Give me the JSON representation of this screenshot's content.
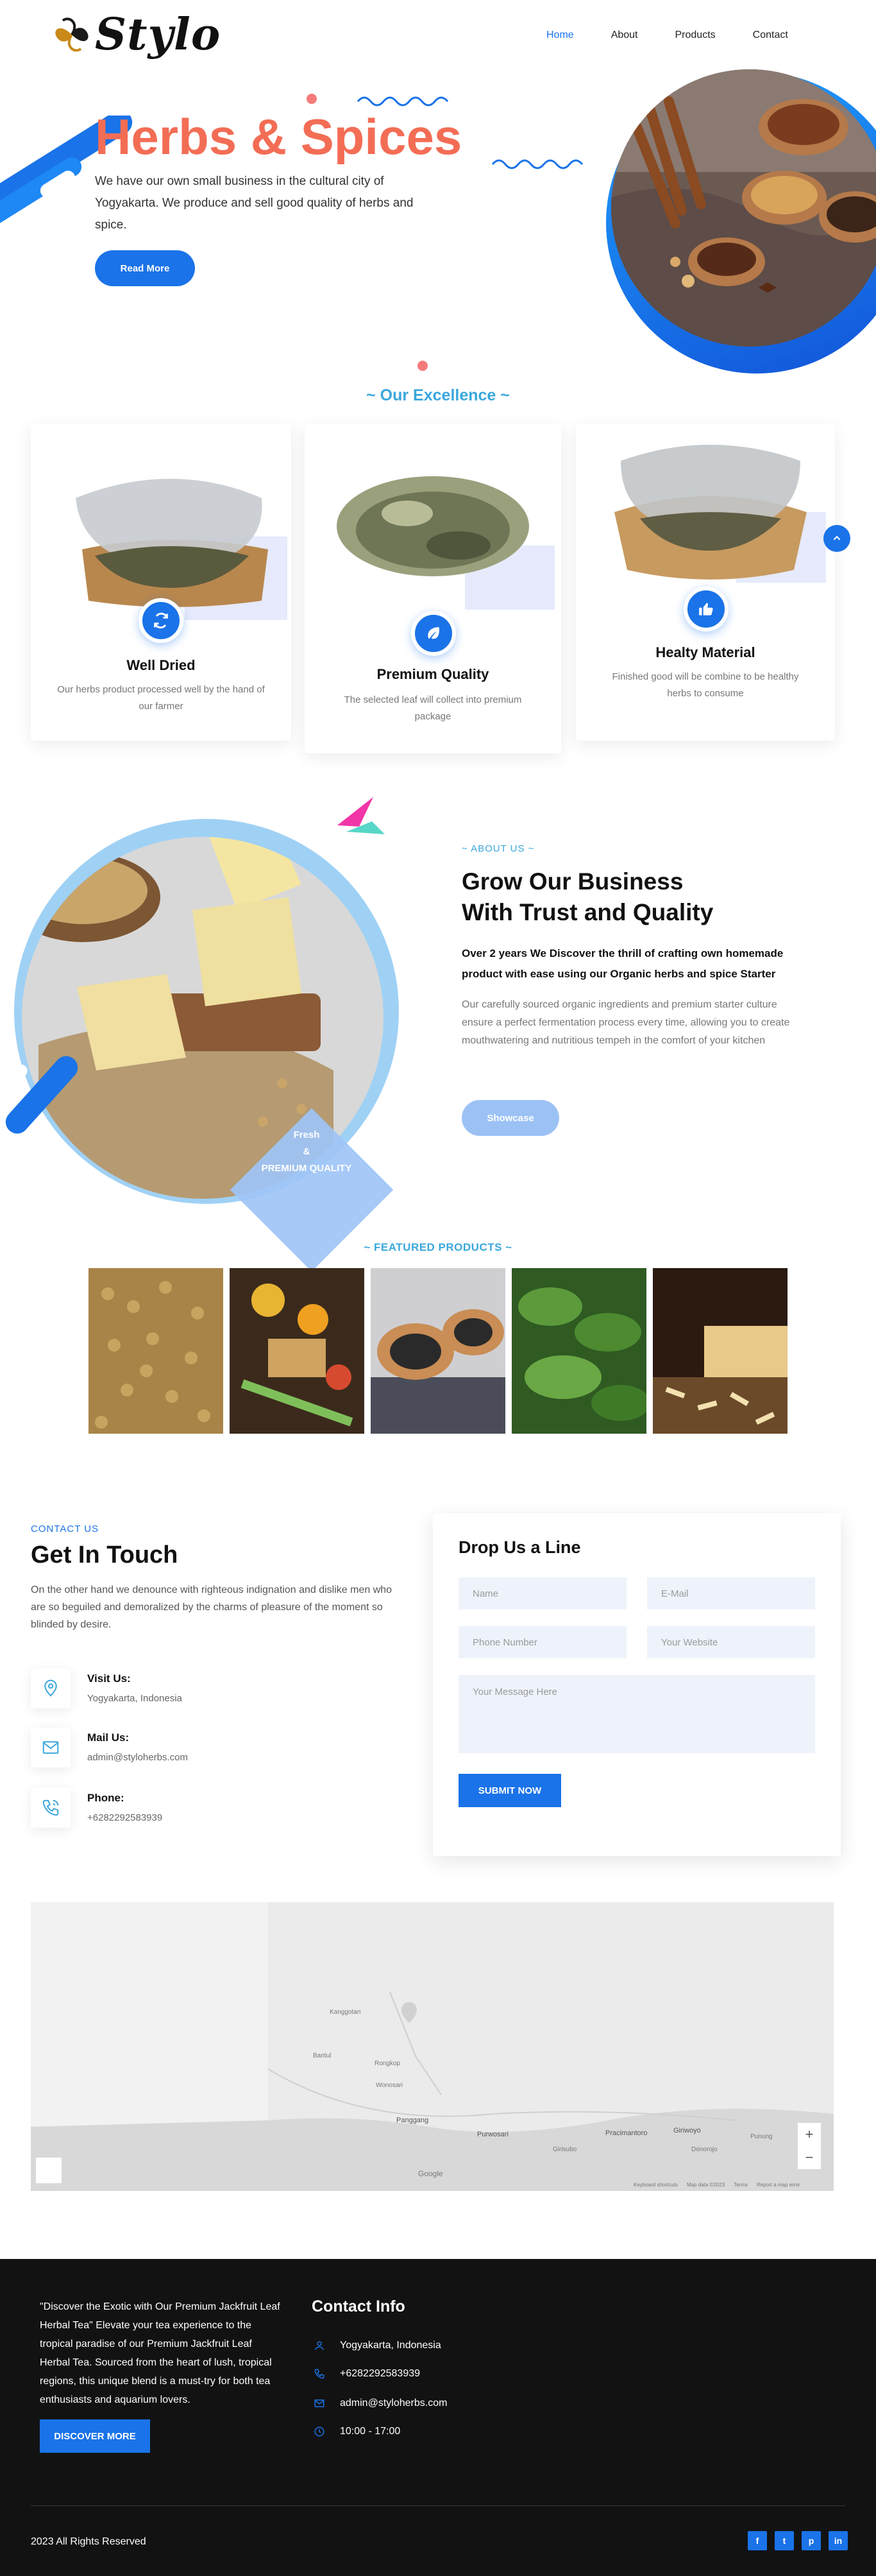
{
  "brand": {
    "name": "Stylo"
  },
  "nav": {
    "items": [
      "Home",
      "About",
      "Products",
      "Contact"
    ],
    "active": "Home"
  },
  "hero": {
    "title": "Herbs & Spices",
    "description": "We have our own small business in the cultural city of Yogyakarta. We produce and sell good quality of herbs and spice.",
    "button": "Read More"
  },
  "excellence": {
    "title": "~ Our Excellence ~",
    "cards": [
      {
        "title": "Well Dried",
        "text": "Our herbs product processed well by the hand of our farmer",
        "icon": "refresh-icon"
      },
      {
        "title": "Premium Quality",
        "text": "The selected leaf will collect into premium package",
        "icon": "leaf-icon"
      },
      {
        "title": "Healty Material",
        "text": "Finished good will be combine to be healthy herbs to consume",
        "icon": "thumbs-up-icon"
      }
    ]
  },
  "about": {
    "label": "~ ABOUT US ~",
    "title_line1": "Grow Our Business",
    "title_line2": "With Trust and Quality",
    "strong": "Over 2 years  We Discover the thrill of crafting own homemade product with ease using our Organic herbs and spice Starter",
    "text": "Our carefully sourced organic ingredients and premium starter culture ensure a perfect fermentation process every time, allowing you to create mouthwatering and nutritious tempeh in the comfort of your kitchen",
    "button": "Showcase",
    "badge_line1": "Fresh",
    "badge_line2": "&",
    "badge_line3": "PREMIUM QUALITY"
  },
  "featured": {
    "title": "~ FEATURED PRODUCTS ~"
  },
  "contact": {
    "label": "CONTACT US",
    "title": "Get In Touch",
    "text": "On the other hand we denounce with righteous indignation and dislike men who are so beguiled and demoralized by the charms of pleasure of the moment so blinded by desire.",
    "items": [
      {
        "head": "Visit Us:",
        "value": "Yogyakarta, Indonesia"
      },
      {
        "head": "Mail Us:",
        "value": "admin@styloherbs.com"
      },
      {
        "head": "Phone:",
        "value": "+6282292583939"
      }
    ]
  },
  "form": {
    "title": "Drop Us a Line",
    "name_placeholder": "Name",
    "email_placeholder": "E-Mail",
    "phone_placeholder": "Phone Number",
    "website_placeholder": "Your Website",
    "message_placeholder": "Your Message Here",
    "submit": "SUBMIT NOW"
  },
  "map": {
    "labels": [
      "Panggang",
      "Purwosari",
      "Pracimantoro",
      "Giriwoyo",
      "Wonosari",
      "Bantul",
      "Kanggotan",
      "Girisubo",
      "Rongkop",
      "Donorojo",
      "Punung"
    ],
    "footer": [
      "Keyboard shortcuts",
      "Map data ©2023",
      "Terms",
      "Report a map error"
    ],
    "google": "Google"
  },
  "footer": {
    "quote": "\"Discover the Exotic with Our Premium Jackfruit Leaf Herbal Tea\" Elevate your tea experience to the tropical paradise of our Premium Jackfruit Leaf Herbal Tea. Sourced from the heart of lush, tropical regions, this unique blend is a must-try for both tea enthusiasts and aquarium lovers.",
    "button": "DISCOVER MORE",
    "contact_title": "Contact Info",
    "address": "Yogyakarta, Indonesia",
    "phone": "+6282292583939",
    "email": "admin@styloherbs.com",
    "hours": "10:00 - 17:00",
    "copyright": "2023 All Rights Reserved",
    "socials": [
      "f",
      "t",
      "p",
      "in"
    ]
  },
  "colors": {
    "accent": "#1a73e8",
    "hero_title": "#f36d55",
    "section_title": "#3aa7dc",
    "footer_bg": "#121212"
  }
}
